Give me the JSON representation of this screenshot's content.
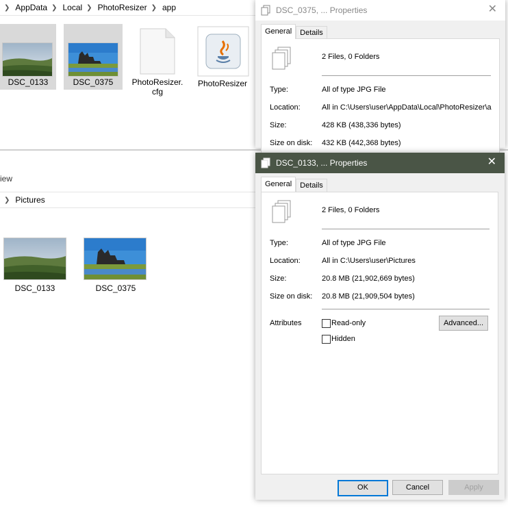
{
  "top_explorer": {
    "breadcrumb": [
      "AppData",
      "Local",
      "PhotoResizer",
      "app"
    ],
    "files": [
      {
        "name": "DSC_0133",
        "kind": "image-hills",
        "selected": true
      },
      {
        "name": "DSC_0375",
        "kind": "image-abbey",
        "selected": true
      },
      {
        "name": "PhotoResizer.\ncfg",
        "kind": "doc",
        "selected": false
      },
      {
        "name": "PhotoResizer",
        "kind": "java-app",
        "selected": false
      }
    ]
  },
  "bottom_explorer": {
    "ribbon_fragment": "iew",
    "breadcrumb": [
      "Pictures"
    ],
    "files": [
      {
        "name": "DSC_0133",
        "kind": "image-hills"
      },
      {
        "name": "DSC_0375",
        "kind": "image-abbey"
      }
    ]
  },
  "dialog_back": {
    "title": "DSC_0375, ... Properties",
    "tabs": [
      "General",
      "Details"
    ],
    "summary": "2 Files, 0 Folders",
    "type_label": "Type:",
    "type_value": "All of type JPG File",
    "location_label": "Location:",
    "location_value": "All in C:\\Users\\user\\AppData\\Local\\PhotoResizer\\a",
    "size_label": "Size:",
    "size_value": "428 KB (438,336 bytes)",
    "disk_label": "Size on disk:",
    "disk_value": "432 KB (442,368 bytes)"
  },
  "dialog_front": {
    "title": "DSC_0133, ... Properties",
    "tabs": [
      "General",
      "Details"
    ],
    "summary": "2 Files, 0 Folders",
    "type_label": "Type:",
    "type_value": "All of type JPG File",
    "location_label": "Location:",
    "location_value": "All in C:\\Users\\user\\Pictures",
    "size_label": "Size:",
    "size_value": "20.8 MB (21,902,669 bytes)",
    "disk_label": "Size on disk:",
    "disk_value": "20.8 MB (21,909,504 bytes)",
    "attributes_label": "Attributes",
    "readonly_label": "Read-only",
    "hidden_label": "Hidden",
    "advanced_label": "Advanced...",
    "ok_label": "OK",
    "cancel_label": "Cancel",
    "apply_label": "Apply"
  },
  "icons": {
    "close": "close-icon",
    "chevron": "chevron-right-icon",
    "files": "multiple-files-icon"
  },
  "colors": {
    "active_titlebar": "#4a5546",
    "inactive_titlebar": "#ffffff",
    "selection": "#d9d9d9",
    "focus": "#0078d7"
  }
}
